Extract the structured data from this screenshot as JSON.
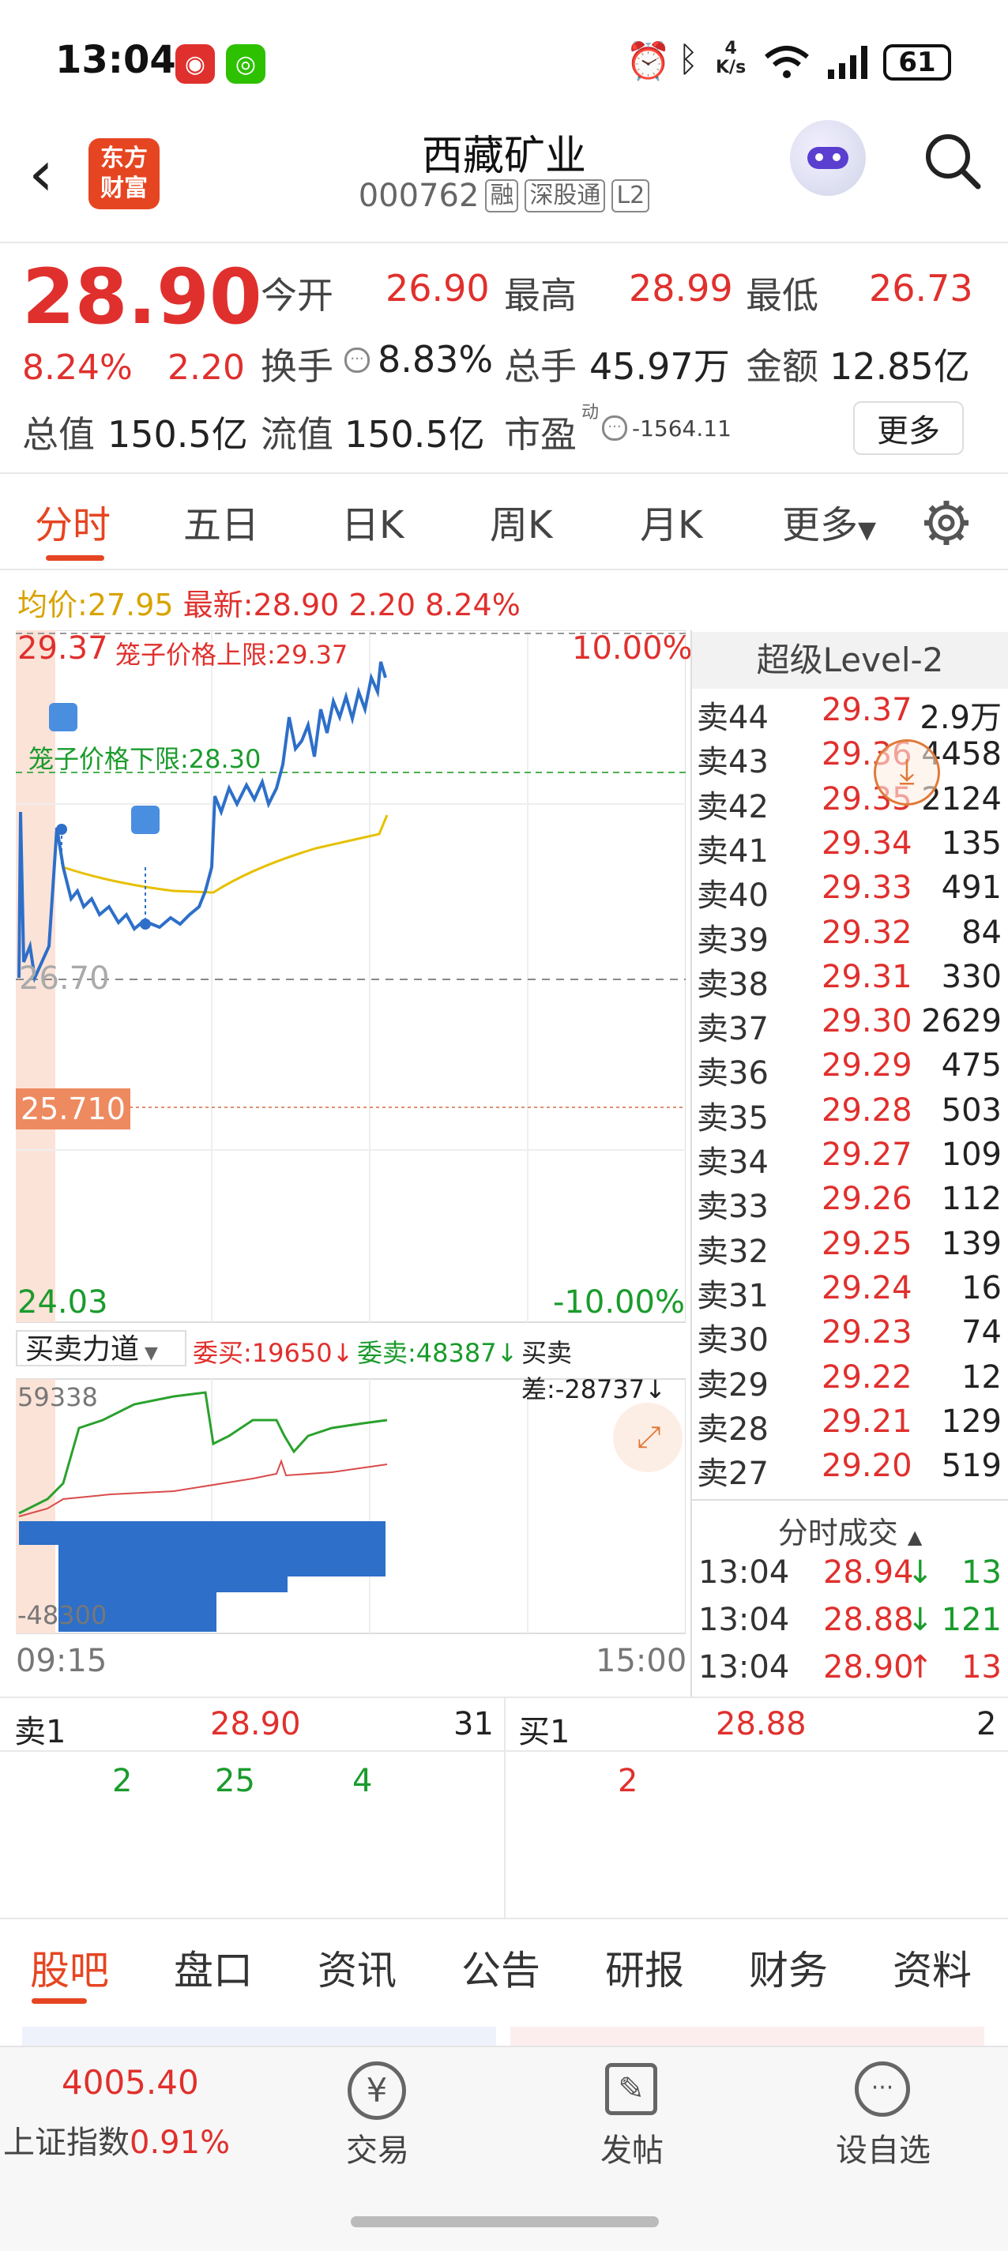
{
  "status_bar": {
    "time": "13:04",
    "network_speed_top": "4",
    "network_speed_bottom": "K/s",
    "battery": "61"
  },
  "header": {
    "title": "西藏矿业",
    "code": "000762",
    "tags": [
      "融",
      "深股通",
      "L2"
    ],
    "logo_line1": "东方",
    "logo_line2": "财富"
  },
  "quote": {
    "price": "28.90",
    "change_pct": "8.24%",
    "change": "2.20",
    "open_label": "今开",
    "open": "26.90",
    "high_label": "最高",
    "high": "28.99",
    "low_label": "最低",
    "low": "26.73",
    "turnover_label": "换手",
    "turnover": "8.83%",
    "volume_label": "总手",
    "volume": "45.97万",
    "amount_label": "金额",
    "amount": "12.85亿",
    "mcap_label": "总值",
    "mcap": "150.5亿",
    "float_label": "流值",
    "float": "150.5亿",
    "pe_label": "市盈",
    "pe_sup": "动",
    "pe": "-1564.11",
    "more": "更多"
  },
  "tabs": [
    "分时",
    "五日",
    "日K",
    "周K",
    "月K",
    "更多"
  ],
  "info_line": {
    "avg_label": "均价:",
    "avg": "27.95",
    "latest_label": "最新:",
    "latest": "28.90",
    "change": "2.20",
    "pct": "8.24%"
  },
  "chart": {
    "top_price": "29.37",
    "top_pct": "10.00%",
    "upper_limit": "笼子价格上限:29.37",
    "lower_limit": "笼子价格下限:28.30",
    "mid_price": "26.70",
    "ref_price": "25.710",
    "bottom_price": "24.03",
    "bottom_pct": "-10.00%",
    "indicator_label": "买卖力道",
    "bid_label": "委买:19650",
    "ask_label": "委卖:48387",
    "diff_label": "买卖差:-28737",
    "sub_top": "59338",
    "sub_bottom": "-48300",
    "time_start": "09:15",
    "time_end": "15:00"
  },
  "level2": {
    "title": "超级Level-2",
    "asks": [
      {
        "label": "卖44",
        "price": "29.37",
        "vol": "2.9万"
      },
      {
        "label": "卖43",
        "price": "29.36",
        "vol": "4458"
      },
      {
        "label": "卖42",
        "price": "29.35",
        "vol": "2124"
      },
      {
        "label": "卖41",
        "price": "29.34",
        "vol": "135"
      },
      {
        "label": "卖40",
        "price": "29.33",
        "vol": "491"
      },
      {
        "label": "卖39",
        "price": "29.32",
        "vol": "84"
      },
      {
        "label": "卖38",
        "price": "29.31",
        "vol": "330"
      },
      {
        "label": "卖37",
        "price": "29.30",
        "vol": "2629"
      },
      {
        "label": "卖36",
        "price": "29.29",
        "vol": "475"
      },
      {
        "label": "卖35",
        "price": "29.28",
        "vol": "503"
      },
      {
        "label": "卖34",
        "price": "29.27",
        "vol": "109"
      },
      {
        "label": "卖33",
        "price": "29.26",
        "vol": "112"
      },
      {
        "label": "卖32",
        "price": "29.25",
        "vol": "139"
      },
      {
        "label": "卖31",
        "price": "29.24",
        "vol": "16"
      },
      {
        "label": "卖30",
        "price": "29.23",
        "vol": "74"
      },
      {
        "label": "卖29",
        "price": "29.22",
        "vol": "12"
      },
      {
        "label": "卖28",
        "price": "29.21",
        "vol": "129"
      },
      {
        "label": "卖27",
        "price": "29.20",
        "vol": "519"
      }
    ],
    "trades_title": "分时成交",
    "trades": [
      {
        "time": "13:04",
        "price": "28.94",
        "dir": "↓",
        "vol": "13"
      },
      {
        "time": "13:04",
        "price": "28.88",
        "dir": "↓",
        "vol": "121"
      },
      {
        "time": "13:04",
        "price": "28.90",
        "dir": "↑",
        "vol": "13"
      }
    ]
  },
  "order_queue": {
    "sell1_label": "卖1",
    "sell1_price": "28.90",
    "sell1_vol": "31",
    "buy1_label": "买1",
    "buy1_price": "28.88",
    "buy1_vol": "2",
    "sell_queue": [
      "2",
      "25",
      "4"
    ],
    "buy_queue": [
      "2"
    ]
  },
  "bottom_tabs": [
    "股吧",
    "盘口",
    "资讯",
    "公告",
    "研报",
    "财务",
    "资料"
  ],
  "bottom_nav": {
    "index_value": "4005.40",
    "index_name": "上证指数",
    "index_pct": "0.91%",
    "trade": "交易",
    "post": "发帖",
    "watch": "设自选"
  }
}
